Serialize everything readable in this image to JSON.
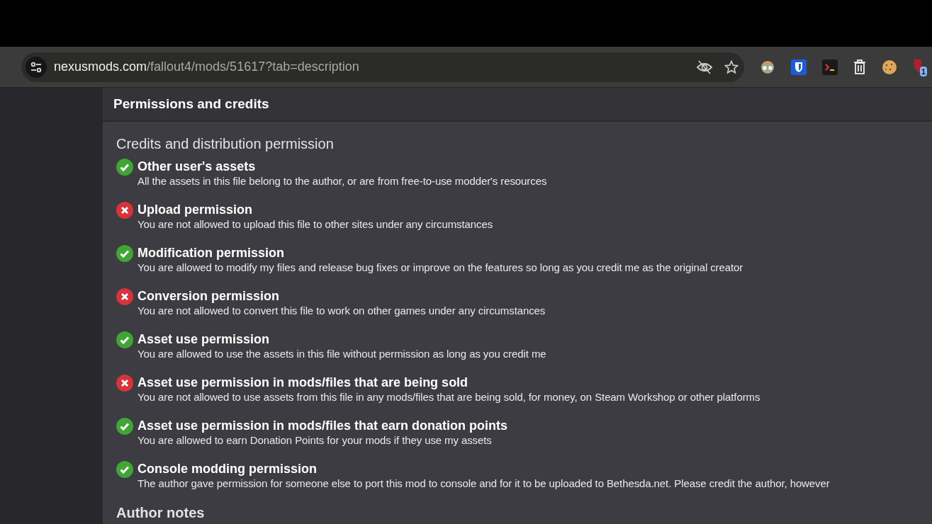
{
  "browser": {
    "url_host": "nexusmods.com",
    "url_path": "/fallout4/mods/51617?tab=description",
    "extension_badge": "1"
  },
  "panel": {
    "title": "Permissions and credits",
    "section_title": "Credits and distribution permission",
    "permissions": [
      {
        "title": "Other user's assets",
        "description": "All the assets in this file belong to the author, or are from free-to-use modder's resources",
        "allowed": true
      },
      {
        "title": "Upload permission",
        "description": "You are not allowed to upload this file to other sites under any circumstances",
        "allowed": false
      },
      {
        "title": "Modification permission",
        "description": "You are allowed to modify my files and release bug fixes or improve on the features so long as you credit me as the original creator",
        "allowed": true
      },
      {
        "title": "Conversion permission",
        "description": "You are not allowed to convert this file to work on other games under any circumstances",
        "allowed": false
      },
      {
        "title": "Asset use permission",
        "description": "You are allowed to use the assets in this file without permission as long as you credit me",
        "allowed": true
      },
      {
        "title": "Asset use permission in mods/files that are being sold",
        "description": "You are not allowed to use assets from this file in any mods/files that are being sold, for money, on Steam Workshop or other platforms",
        "allowed": false
      },
      {
        "title": "Asset use permission in mods/files that earn donation points",
        "description": "You are allowed to earn Donation Points for your mods if they use my assets",
        "allowed": true
      },
      {
        "title": "Console modding permission",
        "description": "The author gave permission for someone else to port this mod to console and for it to be uploaded to Bethesda.net. Please credit the author, however",
        "allowed": true
      }
    ],
    "notes_title": "Author notes"
  }
}
